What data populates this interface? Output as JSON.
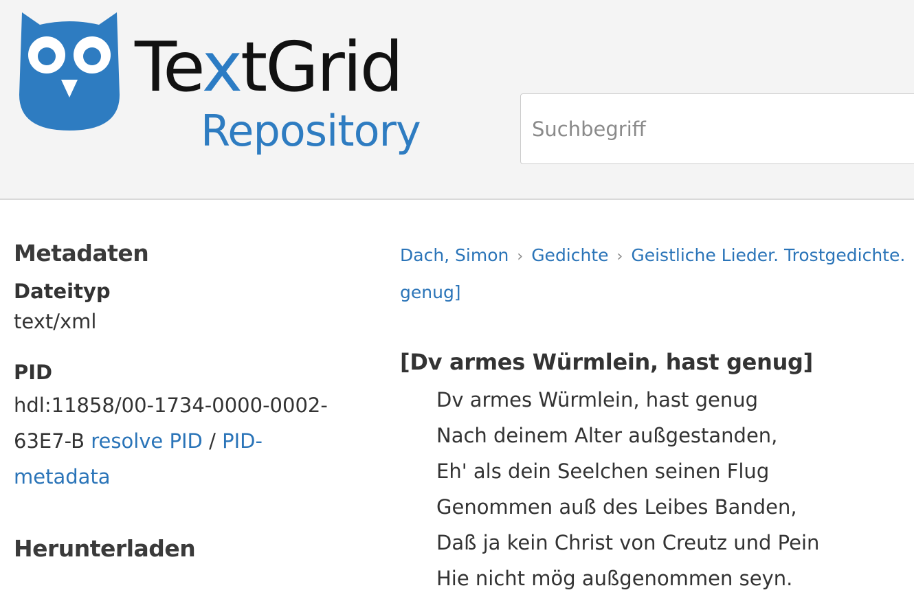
{
  "header": {
    "brand_prefix": "Te",
    "brand_x": "x",
    "brand_suffix": "tGrid",
    "brand_sub": "Repository",
    "logo_icon": "owl-icon",
    "search_placeholder": "Suchbegriff",
    "search_value": ""
  },
  "sidebar": {
    "metadata_heading": "Metadaten",
    "filetype_label": "Dateityp",
    "filetype_value": "text/xml",
    "pid_label": "PID",
    "pid_line1": "hdl:11858/00-1734-0000-0002-",
    "pid_line2_prefix": "63E7-B",
    "resolve_link": "resolve PID",
    "slash": "/",
    "pid_meta_link_a": "PID-",
    "pid_meta_link_b": "metadata",
    "download_heading": "Herunterladen"
  },
  "breadcrumb": {
    "items": [
      "Dach, Simon",
      "Gedichte",
      "Geistliche Lieder. Trostgedichte."
    ],
    "separator": "›",
    "continuation": "genug]"
  },
  "document": {
    "title": "[Dv armes Würmlein, hast genug]",
    "lines": [
      "Dv armes Würmlein, hast genug",
      "Nach deinem Alter außgestanden,",
      "Eh' als dein Seelchen seinen Flug",
      "Genommen auß des Leibes Banden,",
      "Daß ja kein Christ von Creutz und Pein",
      "Hie nicht mög außgenommen seyn."
    ]
  },
  "colors": {
    "brand_blue": "#2e7cc1",
    "link_blue": "#2a74b8",
    "header_bg": "#f4f4f4"
  }
}
